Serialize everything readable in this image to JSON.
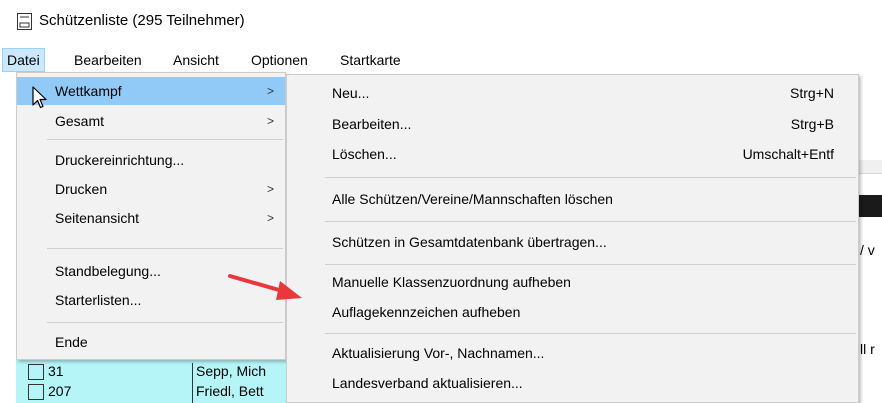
{
  "window": {
    "title": "Schützenliste (295 Teilnehmer)"
  },
  "menubar": {
    "items": [
      {
        "label": "Datei"
      },
      {
        "label": "Bearbeiten"
      },
      {
        "label": "Ansicht"
      },
      {
        "label": "Optionen"
      },
      {
        "label": "Startkarte"
      }
    ]
  },
  "datei_menu": {
    "items": [
      {
        "label": "Wettkampf",
        "submenu_arrow": ">"
      },
      {
        "label": "Gesamt",
        "submenu_arrow": ">"
      },
      {
        "label": "Druckereinrichtung..."
      },
      {
        "label": "Drucken",
        "submenu_arrow": ">"
      },
      {
        "label": "Seitenansicht",
        "submenu_arrow": ">"
      },
      {
        "label": "Standbelegung..."
      },
      {
        "label": "Starterlisten..."
      },
      {
        "label": "Ende"
      }
    ]
  },
  "wettkampf_submenu": {
    "items": [
      {
        "label": "Neu...",
        "shortcut": "Strg+N"
      },
      {
        "label": "Bearbeiten...",
        "shortcut": "Strg+B"
      },
      {
        "label": "Löschen...",
        "shortcut": "Umschalt+Entf"
      },
      {
        "label": "Alle Schützen/Vereine/Mannschaften löschen"
      },
      {
        "label": "Schützen in Gesamtdatenbank übertragen..."
      },
      {
        "label": "Manuelle Klassenzuordnung aufheben"
      },
      {
        "label": "Auflagekennzeichen aufheben"
      },
      {
        "label": "Aktualisierung Vor-, Nachnamen..."
      },
      {
        "label": "Landesverband aktualisieren..."
      }
    ]
  },
  "background": {
    "right_fragments": [
      "/ v",
      "ll r"
    ],
    "rows": [
      {
        "number": "31",
        "name": "Sepp, Mich"
      },
      {
        "number": "207",
        "name": "Friedl, Bett"
      }
    ]
  },
  "colors": {
    "menu_hover": "#91c9f7",
    "menubar_active": "#cce8ff",
    "row_background": "#b5f5f7",
    "annotation_arrow": "#e8383d"
  },
  "icons": {
    "app": "document-icon",
    "cursor": "mouse-pointer-icon",
    "annotation": "red-arrow-icon"
  }
}
